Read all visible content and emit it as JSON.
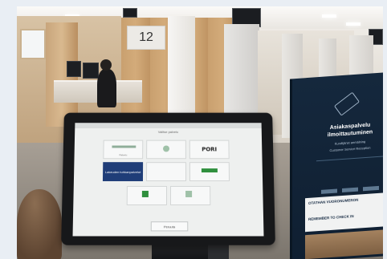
{
  "scene": {
    "counter_number": "12"
  },
  "kiosk": {
    "screen_title": "Valitse palvelu",
    "tiles": [
      {
        "label": "Palvelu",
        "text": ""
      },
      {
        "label": "",
        "text": ""
      },
      {
        "label": "",
        "text": "PORI"
      },
      {
        "label": "",
        "text": "Lakeuden tuhkanpalvelut"
      },
      {
        "label": "",
        "text": ""
      },
      {
        "label": "",
        "text": ""
      },
      {
        "label": "",
        "text": ""
      },
      {
        "label": "",
        "text": ""
      }
    ],
    "cancel_button": "Peruuta"
  },
  "service_sign": {
    "title": "Asiakaspalvelu ilmoittautuminen",
    "subtitle_fi": "Kundtjänst anmälning",
    "subtitle_en": "Customer Service Reception",
    "take_number": "OTATHAN VUORONUMERON",
    "remember": "REMEMBER TO CHECK IN"
  },
  "colors": {
    "kiosk_blue_tile": "#1f3d78",
    "sign_navy": "#15283d",
    "pori_green": "#2f8f3d"
  }
}
